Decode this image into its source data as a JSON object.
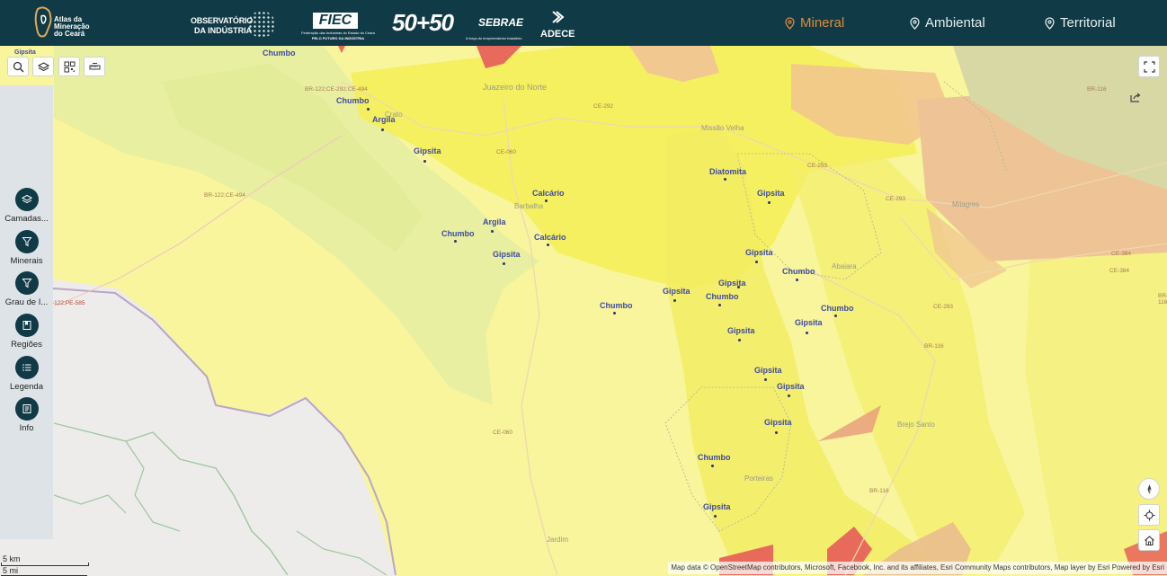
{
  "header": {
    "logo_text": [
      "Atlas da",
      "Mineração",
      "do Ceará"
    ],
    "partners": {
      "observatorio": [
        "OBSERVATÓRIO",
        "DA INDÚSTRIA"
      ],
      "fiec": "FIEC",
      "fiec_sub1": "Federação das Indústrias do Estado do Ceará",
      "fiec_sub2": "PELO FUTURO DA INDÚSTRIA",
      "fifty": "50+50",
      "sebrae": "SEBRAE",
      "sebrae_sub": "A força do empreendedor brasileiro",
      "adece": "ADECE"
    },
    "nav": [
      {
        "label": "Mineral",
        "active": true
      },
      {
        "label": "Ambiental",
        "active": false
      },
      {
        "label": "Territorial",
        "active": false
      }
    ],
    "active_color": "#e08c3c",
    "bg_color": "#0f3a46"
  },
  "toolbar": {
    "icons": [
      "search-icon",
      "layers-icon",
      "qr-code-icon",
      "measure-icon"
    ]
  },
  "sidebar": {
    "items": [
      {
        "label": "Camadas...",
        "icon": "layers-icon"
      },
      {
        "label": "Minerais",
        "icon": "filter-icon"
      },
      {
        "label": "Grau de I...",
        "icon": "filter-icon"
      },
      {
        "label": "Regiões",
        "icon": "bookmark-icon"
      },
      {
        "label": "Legenda",
        "icon": "list-icon"
      },
      {
        "label": "Info",
        "icon": "info-icon"
      }
    ]
  },
  "map": {
    "points": [
      {
        "label": "Chumbo"
      },
      {
        "label": "Chumbo"
      },
      {
        "label": "Argila"
      },
      {
        "label": "Gipsita"
      },
      {
        "label": "Calcário"
      },
      {
        "label": "Argila"
      },
      {
        "label": "Chumbo"
      },
      {
        "label": "Calcário"
      },
      {
        "label": "Gipsita"
      },
      {
        "label": "Diatomita"
      },
      {
        "label": "Gipsita"
      },
      {
        "label": "Gipsita"
      },
      {
        "label": "Chumbo"
      },
      {
        "label": "Gipsita"
      },
      {
        "label": "Gipsita"
      },
      {
        "label": "Chumbo"
      },
      {
        "label": "Chumbo"
      },
      {
        "label": "Gipsita"
      },
      {
        "label": "Chumbo"
      },
      {
        "label": "Gipsita"
      },
      {
        "label": "Gipsita"
      },
      {
        "label": "Gipsita"
      },
      {
        "label": "Gipsita"
      },
      {
        "label": "Chumbo"
      },
      {
        "label": "Gipsita"
      },
      {
        "label": "Gipsita"
      }
    ],
    "place_labels": [
      "Juazeiro do Norte",
      "Crato",
      "Missão Velha",
      "Barbalha",
      "Abaiara",
      "Milagres",
      "Brejo Santo",
      "Porteiras",
      "Jardim"
    ],
    "road_labels": [
      "BR-122;CE-292;CE-494",
      "CE-292",
      "CE-060",
      "BR-122;CE-494",
      "CE-293",
      "CE-293",
      "CE-384",
      "CE-384",
      "CE-293",
      "BR-116",
      "BR-116",
      "CE-060",
      "BR-116",
      "BR-116",
      "-122;PE-585"
    ]
  },
  "right_controls": {
    "icons": [
      "fullscreen-icon",
      "share-icon",
      "compass-icon",
      "locate-icon",
      "home-icon"
    ]
  },
  "scale": {
    "km": "5 km",
    "mi": "5 mi"
  },
  "attribution": "Map data © OpenStreetMap contributors, Microsoft, Facebook, Inc. and its affiliates, Esri Community Maps contributors, Map layer by Esri   Powered by Esri"
}
